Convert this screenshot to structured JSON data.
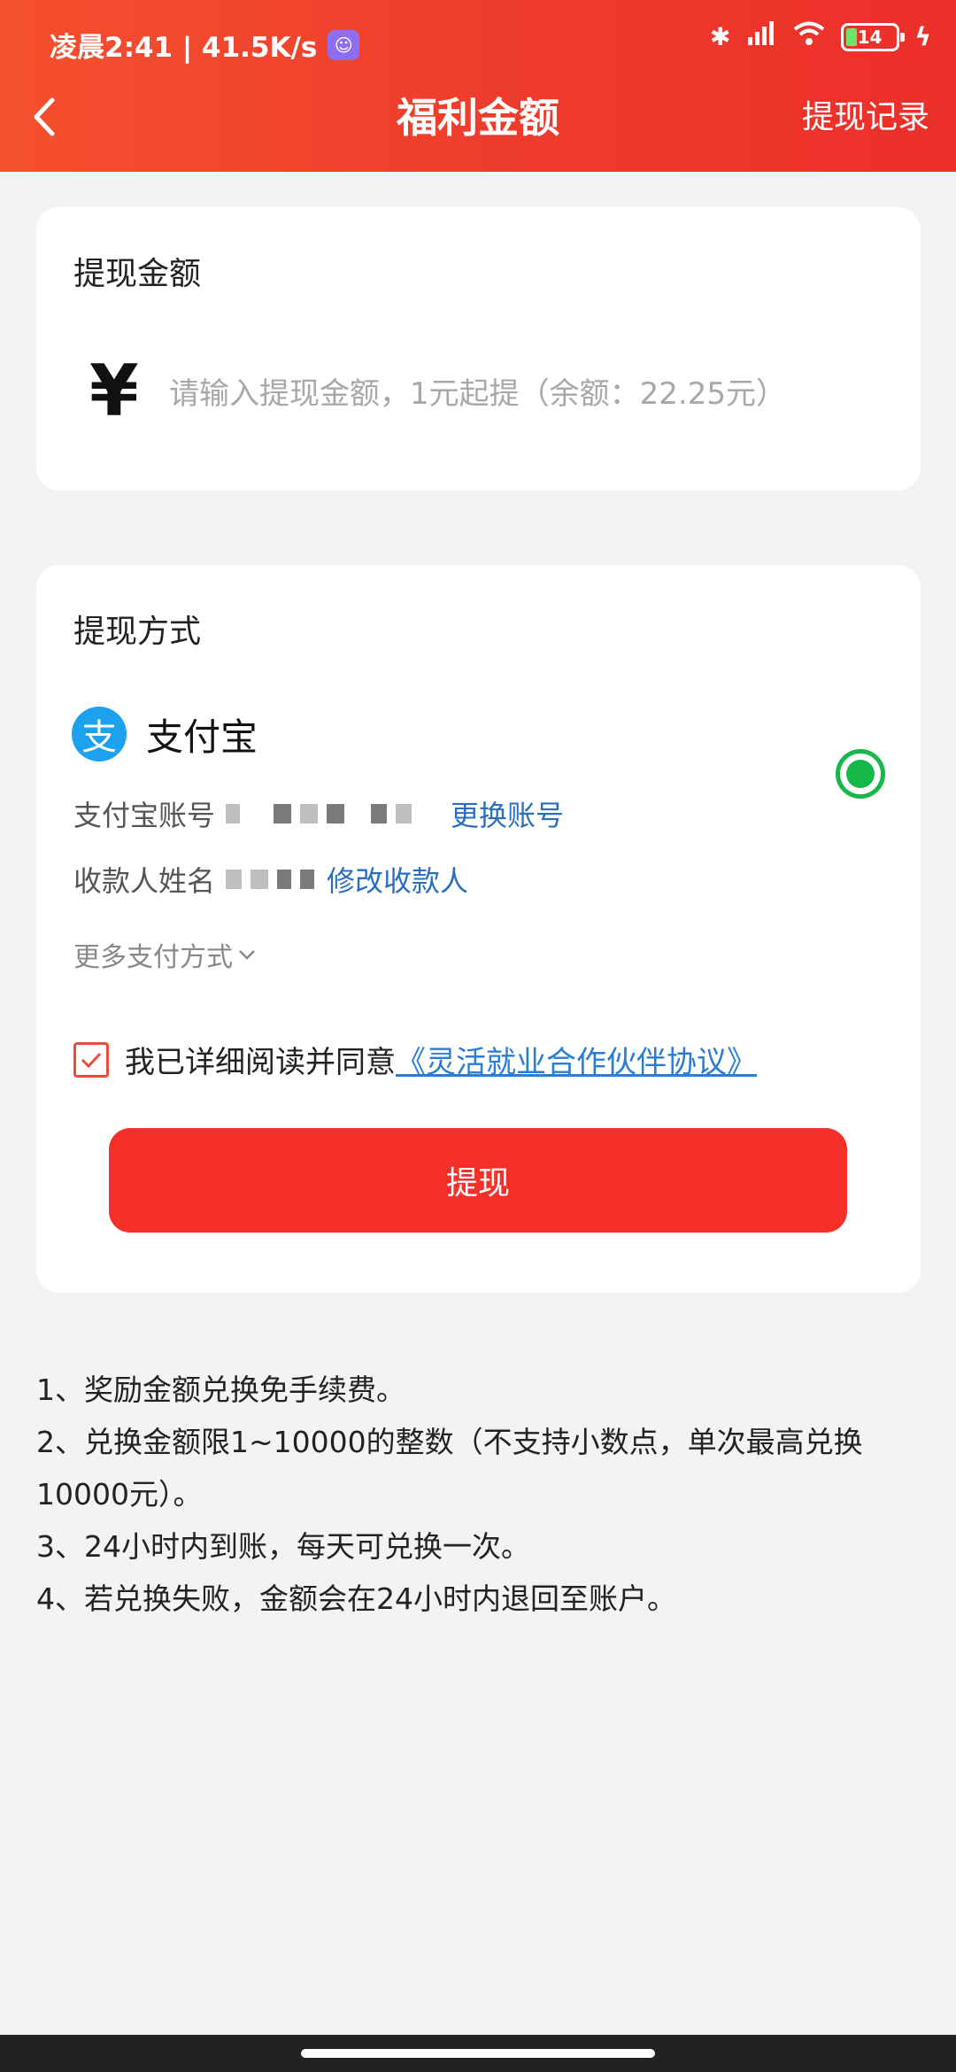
{
  "status_bar": {
    "time_speed": "凌晨2:41 | 41.5K/s",
    "battery": "14"
  },
  "nav": {
    "title": "福利金额",
    "records": "提现记录"
  },
  "amount_card": {
    "title": "提现金额",
    "currency_symbol": "¥",
    "placeholder": "请输入提现金额，1元起提（余额：22.25元）"
  },
  "method_card": {
    "title": "提现方式",
    "alipay_logo": "支",
    "alipay_name": "支付宝",
    "account_label": "支付宝账号",
    "change_account": "更换账号",
    "payee_label": "收款人姓名",
    "edit_payee": "修改收款人",
    "more_methods": "更多支付方式",
    "agree_text": "我已详细阅读并同意",
    "agreement_link": "《灵活就业合作伙伴协议》",
    "withdraw_button": "提现"
  },
  "notes": [
    "1、奖励金额兑换免手续费。",
    "2、兑换金额限1~10000的整数（不支持小数点，单次最高兑换10000元）。",
    "3、24小时内到账，每天可兑换一次。",
    "4、若兑换失败，金额会在24小时内退回至账户。"
  ],
  "colors": {
    "header": "#ee3b2c",
    "button": "#f5302a",
    "link": "#2a6ebd",
    "radio": "#16b84a"
  }
}
